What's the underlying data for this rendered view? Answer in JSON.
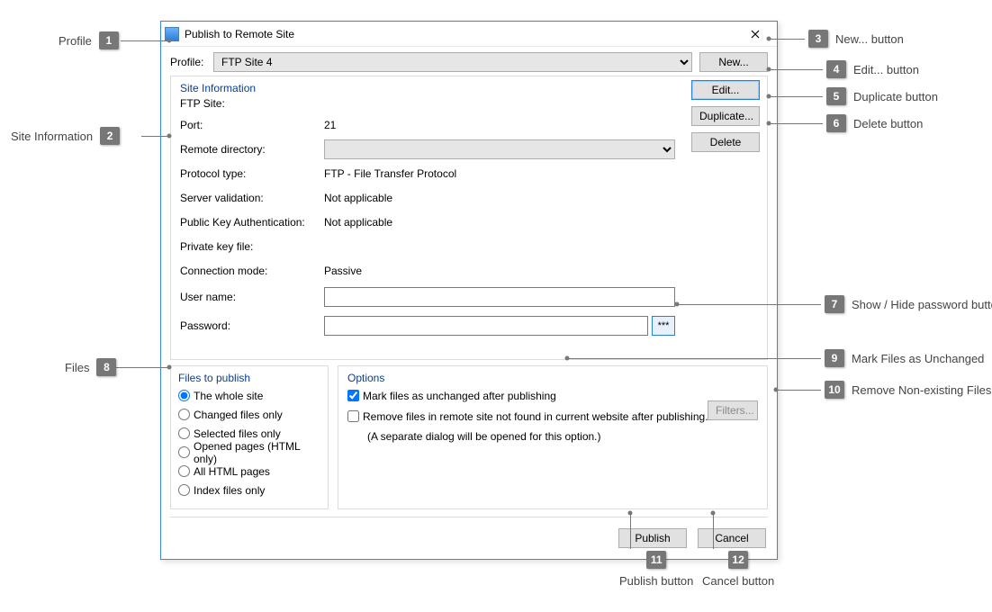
{
  "window": {
    "title": "Publish to Remote Site"
  },
  "profile": {
    "label": "Profile:",
    "selected": "FTP Site 4"
  },
  "buttons": {
    "new": "New...",
    "edit": "Edit...",
    "duplicate": "Duplicate...",
    "delete": "Delete",
    "filters": "Filters...",
    "publish": "Publish",
    "cancel": "Cancel",
    "show_pw": "***"
  },
  "site": {
    "heading": "Site Information",
    "ftp_site_label": "FTP Site:",
    "ftp_site_value": "",
    "port_label": "Port:",
    "port_value": "21",
    "remote_dir_label": "Remote directory:",
    "remote_dir_value": "",
    "protocol_label": "Protocol type:",
    "protocol_value": "FTP - File Transfer Protocol",
    "validation_label": "Server validation:",
    "validation_value": "Not applicable",
    "pubkey_label": "Public Key Authentication:",
    "pubkey_value": "Not applicable",
    "privkey_label": "Private key file:",
    "privkey_value": "",
    "connmode_label": "Connection mode:",
    "connmode_value": "Passive",
    "username_label": "User name:",
    "username_value": "",
    "password_label": "Password:",
    "password_value": ""
  },
  "files": {
    "heading": "Files to publish",
    "options": [
      "The whole site",
      "Changed files only",
      "Selected files only",
      "Opened pages (HTML only)",
      "All HTML pages",
      "Index files only"
    ],
    "selected_index": 0
  },
  "options": {
    "heading": "Options",
    "mark_unchanged": "Mark files as unchanged after publishing",
    "mark_unchanged_checked": true,
    "remove_missing": "Remove files in remote site not found in current website after publishing.",
    "remove_missing_checked": false,
    "remove_note": "(A separate dialog will be opened for this option.)"
  },
  "callouts": {
    "c1": "Profile",
    "c2": "Site Information",
    "c3": "New... button",
    "c4": "Edit... button",
    "c5": "Duplicate button",
    "c6": "Delete button",
    "c7": "Show / Hide password button",
    "c8": "Files",
    "c9": "Mark Files as Unchanged",
    "c10": "Remove Non-existing Files",
    "c11": "Publish button",
    "c12": "Cancel button"
  }
}
